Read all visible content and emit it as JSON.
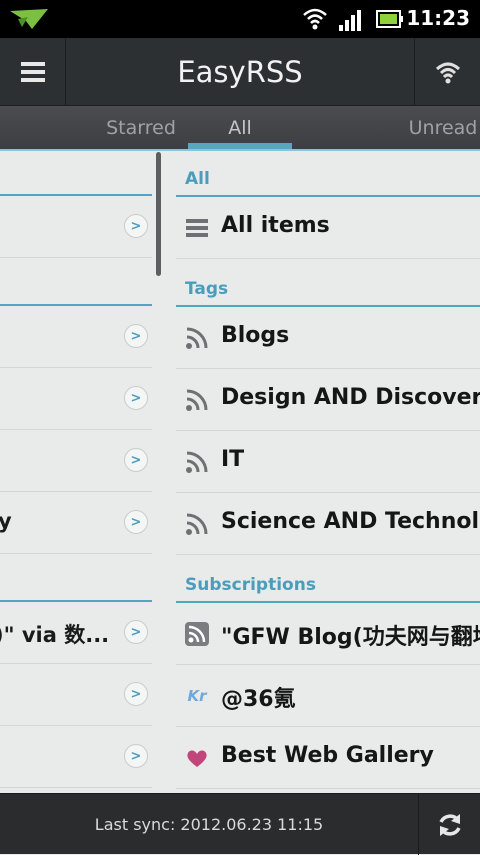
{
  "status_bar": {
    "time": "11:23"
  },
  "app_bar": {
    "title": "EasyRSS"
  },
  "tabs": [
    {
      "label": "Starred",
      "active": false
    },
    {
      "label": "All",
      "active": true
    },
    {
      "label": "Unread",
      "active": false
    }
  ],
  "left_pane": {
    "rows": [
      {
        "text": ""
      },
      {
        "text": ""
      },
      {
        "text": ""
      },
      {
        "text": ""
      },
      {
        "text": "y"
      },
      {
        "text": ")\" via 数..."
      },
      {
        "text": ""
      },
      {
        "text": ""
      }
    ]
  },
  "sections": {
    "all": {
      "header": "All",
      "items": [
        {
          "label": "All items",
          "icon": "list-icon"
        }
      ]
    },
    "tags": {
      "header": "Tags",
      "items": [
        {
          "label": "Blogs",
          "icon": "rss-icon"
        },
        {
          "label": "Design AND Discovery",
          "icon": "rss-icon"
        },
        {
          "label": "IT",
          "icon": "rss-icon"
        },
        {
          "label": "Science AND Technology",
          "icon": "rss-icon"
        }
      ]
    },
    "subscriptions": {
      "header": "Subscriptions",
      "items": [
        {
          "label": "\"GFW Blog(功夫网与翻墙",
          "icon": "feed-favicon-icon"
        },
        {
          "label": "@36氪",
          "icon": "kr-logo-icon",
          "icon_text": "Kr"
        },
        {
          "label": "Best Web Gallery",
          "icon": "heart-icon"
        }
      ]
    }
  },
  "bottom_bar": {
    "sync_text": "Last sync: 2012.06.23 11:15"
  },
  "colors": {
    "accent": "#56a2c2",
    "appbar": "#2d3033",
    "background": "#e8ebe9"
  }
}
